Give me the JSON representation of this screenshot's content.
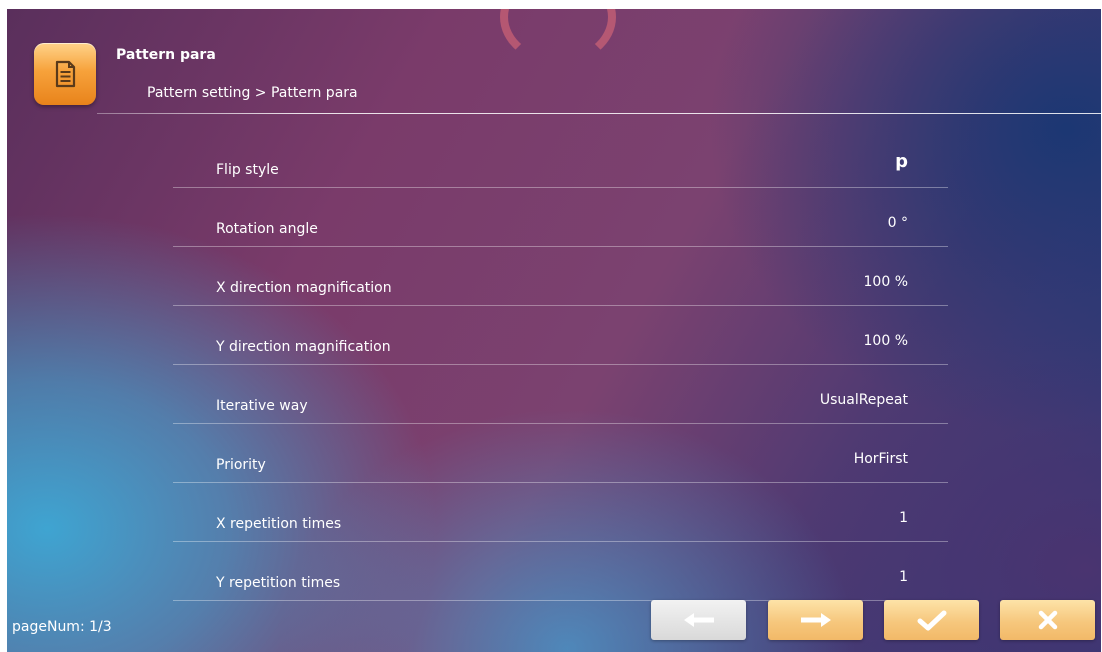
{
  "header": {
    "title": "Pattern para",
    "breadcrumb": "Pattern setting > Pattern para",
    "icon": "document-icon"
  },
  "params": [
    {
      "label": "Flip style",
      "value": "p"
    },
    {
      "label": "Rotation angle",
      "value": "0 °"
    },
    {
      "label": "X direction magnification",
      "value": "100 %"
    },
    {
      "label": "Y direction magnification",
      "value": "100 %"
    },
    {
      "label": "Iterative way",
      "value": "UsualRepeat"
    },
    {
      "label": "Priority",
      "value": "HorFirst"
    },
    {
      "label": "X repetition times",
      "value": "1"
    },
    {
      "label": "Y repetition times",
      "value": "1"
    }
  ],
  "footer": {
    "page_num": "pageNum: 1/3"
  },
  "buttons": {
    "prev_icon": "arrow-left-icon",
    "next_icon": "arrow-right-icon",
    "confirm_icon": "check-icon",
    "cancel_icon": "close-icon"
  },
  "colors": {
    "accent_orange": "#f7a23b",
    "button_orange": "#f6c77d",
    "button_grey": "#d9d9d9",
    "text": "#ffffff"
  }
}
